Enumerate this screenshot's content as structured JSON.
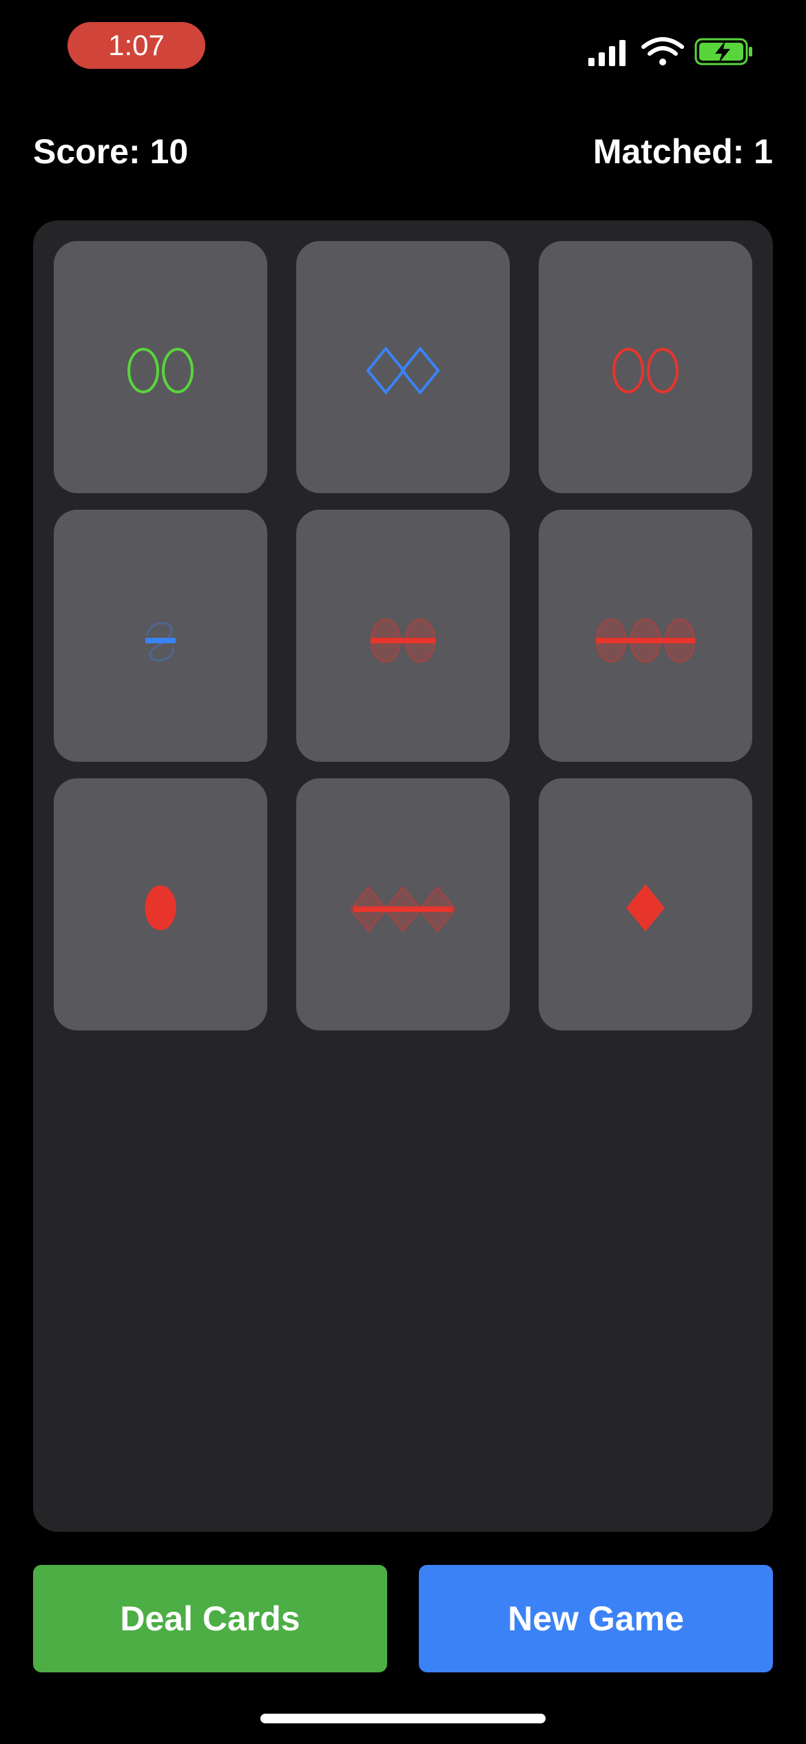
{
  "status_bar": {
    "time": "1:07",
    "icons": [
      "cellular-signal-icon",
      "wifi-icon",
      "battery-charging-icon"
    ],
    "time_pill_color": "#d0443a"
  },
  "header": {
    "score_text": "Score: 10",
    "matched_text": "Matched: 1"
  },
  "cards": [
    {
      "count": 2,
      "shape": "oval",
      "shading": "outline",
      "color": "#58d53b"
    },
    {
      "count": 2,
      "shape": "diamond",
      "shading": "outline",
      "color": "#3a83f6"
    },
    {
      "count": 2,
      "shape": "oval",
      "shading": "outline",
      "color": "#e8352c"
    },
    {
      "count": 1,
      "shape": "squiggle",
      "shading": "striped",
      "color": "#3a83f6"
    },
    {
      "count": 2,
      "shape": "oval",
      "shading": "striped",
      "color": "#e8352c"
    },
    {
      "count": 3,
      "shape": "oval",
      "shading": "striped",
      "color": "#e8352c"
    },
    {
      "count": 1,
      "shape": "oval",
      "shading": "solid",
      "color": "#e8352c"
    },
    {
      "count": 3,
      "shape": "diamond",
      "shading": "striped",
      "color": "#e8352c"
    },
    {
      "count": 1,
      "shape": "diamond",
      "shading": "solid",
      "color": "#e8352c"
    }
  ],
  "buttons": {
    "deal_label": "Deal Cards",
    "new_game_label": "New Game",
    "deal_color": "#4cae45",
    "new_game_color": "#3b82f6"
  },
  "colors": {
    "background": "#000000",
    "board": "#252427",
    "card": "#59585c"
  }
}
